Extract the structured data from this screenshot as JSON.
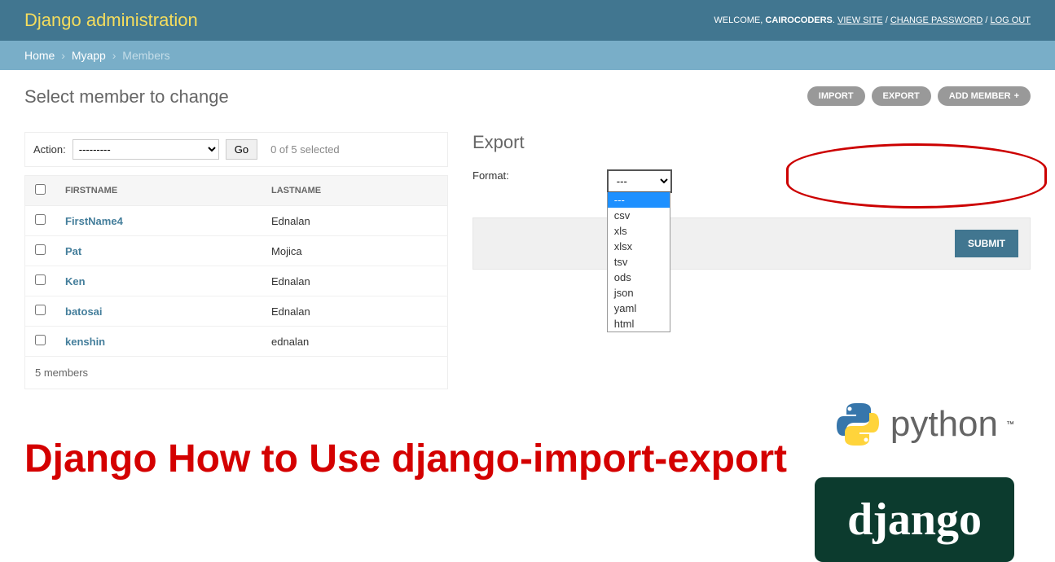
{
  "header": {
    "brand": "Django administration",
    "welcome": "WELCOME,",
    "username": "CAIROCODERS",
    "viewsite": "VIEW SITE",
    "changepw": "CHANGE PASSWORD",
    "logout": "LOG OUT"
  },
  "breadcrumbs": {
    "home": "Home",
    "app": "Myapp",
    "current": "Members"
  },
  "page": {
    "title": "Select member to change"
  },
  "tools": {
    "import": "IMPORT",
    "export": "EXPORT",
    "addmember": "ADD MEMBER"
  },
  "actions": {
    "label": "Action:",
    "default": "---------",
    "go": "Go",
    "selcount": "0 of 5 selected"
  },
  "table": {
    "headers": {
      "firstname": "FIRSTNAME",
      "lastname": "LASTNAME"
    },
    "rows": [
      {
        "firstname": "FirstName4",
        "lastname": "Ednalan"
      },
      {
        "firstname": "Pat",
        "lastname": "Mojica"
      },
      {
        "firstname": "Ken",
        "lastname": "Ednalan"
      },
      {
        "firstname": "batosai",
        "lastname": "Ednalan"
      },
      {
        "firstname": "kenshin",
        "lastname": "ednalan"
      }
    ],
    "footer": "5 members"
  },
  "export": {
    "title": "Export",
    "formatlabel": "Format:",
    "selected": "---",
    "options": [
      "---",
      "csv",
      "xls",
      "xlsx",
      "tsv",
      "ods",
      "json",
      "yaml",
      "html"
    ],
    "submit": "SUBMIT"
  },
  "overlay": {
    "title": "Django How to Use django-import-export",
    "python": "python",
    "tm": "™",
    "django": "django"
  }
}
